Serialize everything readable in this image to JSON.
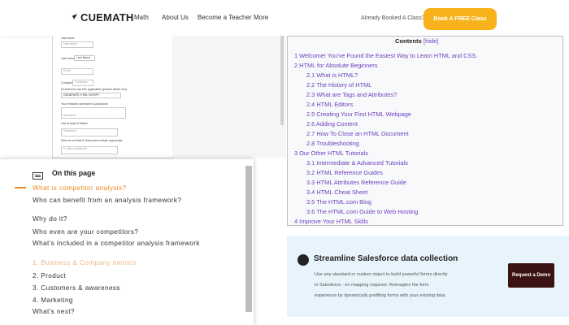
{
  "header": {
    "logo": "CUEMATH",
    "nav": [
      "Math",
      "About Us",
      "Become a Teacher",
      "More"
    ],
    "booked_text": "Already Booked A Class?",
    "book_button": "Book A FREE Class"
  },
  "form": {
    "labels": [
      "Username",
      "Last name",
      "Email",
      "Company",
      "Password",
      "Confirm password"
    ],
    "values": {
      "last_name": "Last Name",
      "company": "Company",
      "username_box": "Username",
      "email_box": "Email",
      "password_box": "Password",
      "confirm_box": "Confirm password"
    },
    "notes": [
      "ID intend to use this application (please select one)",
      "Your reasons username & password",
      "Use at least 6 letters",
      "Must be at least 6 chars and contain uppercase"
    ],
    "select_value": "GENERATE HTML SCRIPT"
  },
  "contents": {
    "title": "Contents",
    "hide_link": "[hide]",
    "items": [
      "1 Welcome! You've Found the Easiest Way to Learn HTML and CSS.",
      "2 HTML for Absolute Beginners",
      "2.1 What is HTML?",
      "2.2 The History of HTML",
      "2.3 What are Tags and Attributes?",
      "2.4 HTML Editors",
      "2.5 Creating Your First HTML Webpage",
      "2.6 Adding Content",
      "2.7 How To Close an HTML Document",
      "2.8 Troubleshooting",
      "3 Our Other HTML Tutorials",
      "3.1 Intermediate & Advanced Tutorials",
      "3.2 HTML Reference Guides",
      "3.3 HTML Attributes Reference Guide",
      "3.4 HTML Cheat Sheet",
      "3.5 The HTML.com Blog",
      "3.6 The HTML.com Guide to Web Hosting",
      "4 Improve Your HTML Skills"
    ]
  },
  "toc": {
    "heading": "On this page",
    "items": [
      "What is competitor analysis?",
      "Who can benefit from an analysis framework?",
      "Why do it?",
      "Who even are your competitors?",
      "What's included in a competitor analysis framework",
      "1. Business & Company metrics",
      "2. Product",
      "3. Customers & awareness",
      "4. Marketing",
      "What's next?"
    ],
    "active_color": "#e8891f",
    "dim_color": "#e8b98a"
  },
  "promo": {
    "title": "Streamline Salesforce data collection",
    "desc": [
      "Use any standard or custom object to build powerful forms directly",
      "in Salesforce - no mapping required. Reimagine the form",
      "experience by dynamically prefilling forms with your existing data."
    ],
    "button": "Request a Demo"
  }
}
